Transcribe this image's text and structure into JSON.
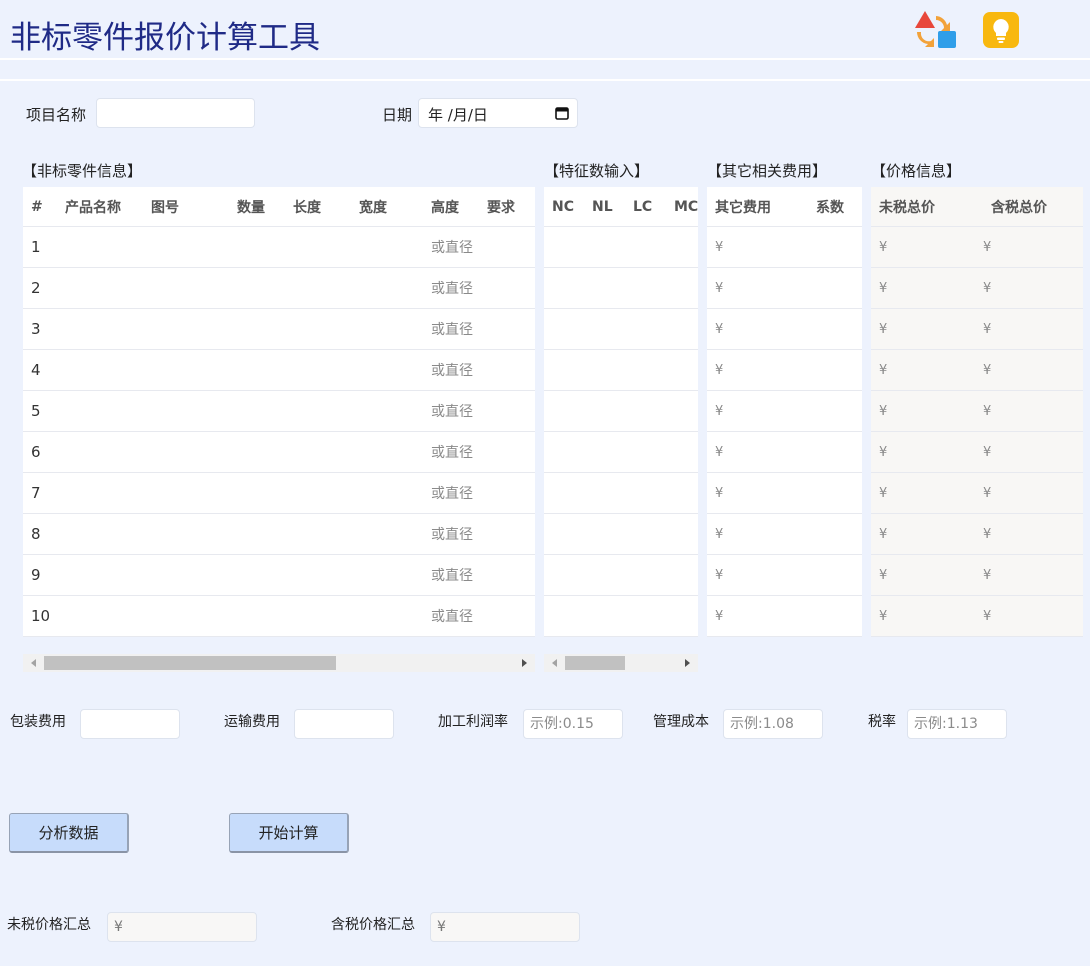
{
  "header": {
    "title": "非标零件报价计算工具"
  },
  "project": {
    "name_label": "项目名称",
    "name_value": "",
    "date_label": "日期",
    "date_value": "年 /月/日"
  },
  "sections": {
    "parts": "【非标零件信息】",
    "features": "【特征数输入】",
    "other_costs": "【其它相关费用】",
    "price": "【价格信息】"
  },
  "parts_table": {
    "headers": [
      "#",
      "产品名称",
      "图号",
      "数量",
      "长度",
      "宽度",
      "高度",
      "要求"
    ],
    "height_hint": "或直径",
    "rows": [
      "1",
      "2",
      "3",
      "4",
      "5",
      "6",
      "7",
      "8",
      "9",
      "10"
    ]
  },
  "features_table": {
    "headers": [
      "NC",
      "NL",
      "LC",
      "MC"
    ]
  },
  "other_table": {
    "headers": [
      "其它费用",
      "系数"
    ],
    "currency": "¥"
  },
  "price_table": {
    "headers": [
      "未税总价",
      "含税总价"
    ],
    "currency": "¥"
  },
  "params": {
    "packing_label": "包装费用",
    "shipping_label": "运输费用",
    "profit_label": "加工利润率",
    "profit_placeholder": "示例:0.15",
    "mgmt_label": "管理成本",
    "mgmt_placeholder": "示例:1.08",
    "tax_label": "税率",
    "tax_placeholder": "示例:1.13"
  },
  "buttons": {
    "analyze": "分析数据",
    "calculate": "开始计算"
  },
  "totals": {
    "untaxed_label": "未税价格汇总",
    "untaxed_value": "¥",
    "taxed_label": "含税价格汇总",
    "taxed_value": "¥"
  },
  "icons": {
    "app": "shapes-icon",
    "tip": "lightbulb-icon"
  },
  "colors": {
    "title": "#1f2a86",
    "background": "#edf2fd",
    "button": "#c7dcfb",
    "bulb": "#f8b80f"
  }
}
